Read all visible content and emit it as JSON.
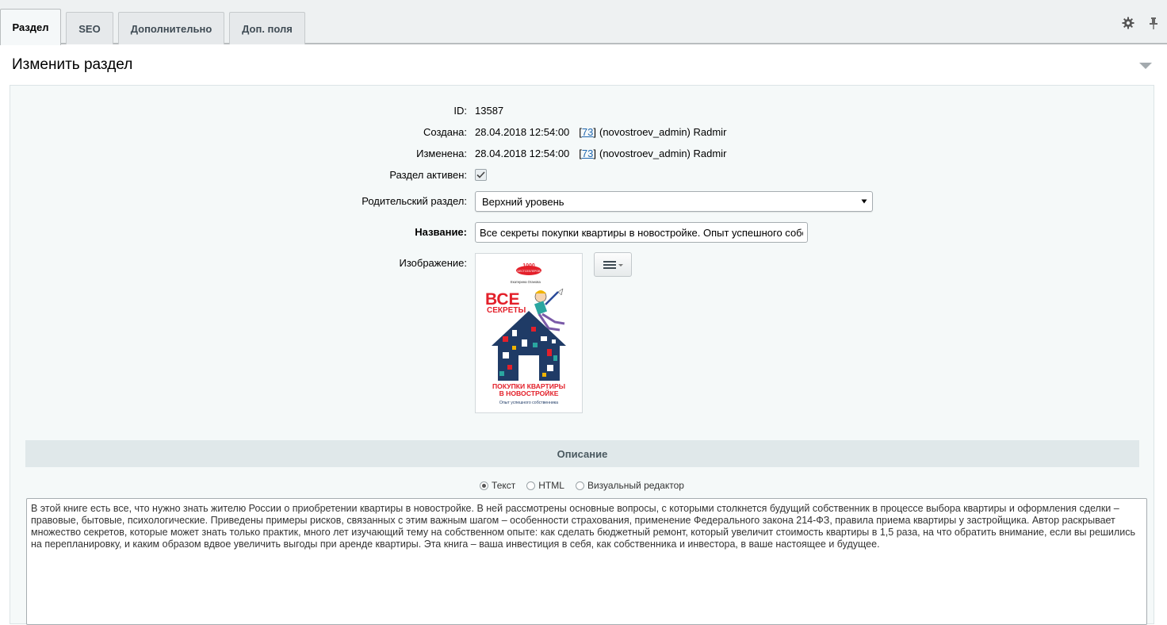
{
  "tabs": [
    {
      "label": "Раздел",
      "active": true
    },
    {
      "label": "SEO",
      "active": false
    },
    {
      "label": "Дополнительно",
      "active": false
    },
    {
      "label": "Доп. поля",
      "active": false
    }
  ],
  "header": {
    "title": "Изменить раздел"
  },
  "form": {
    "id": {
      "label": "ID:",
      "value": "13587"
    },
    "created": {
      "label": "Создана:",
      "date": "28.04.2018 12:54:00",
      "user_open": "[",
      "user_id": "73",
      "user_close": "]",
      "user_name": "(novostroev_admin) Radmir"
    },
    "modified": {
      "label": "Изменена:",
      "date": "28.04.2018 12:54:00",
      "user_open": "[",
      "user_id": "73",
      "user_close": "]",
      "user_name": "(novostroev_admin) Radmir"
    },
    "active": {
      "label": "Раздел активен:",
      "checked": true
    },
    "parent": {
      "label": "Родительский раздел:",
      "value": "Верхний уровень"
    },
    "name": {
      "label": "Название:",
      "value": "Все секреты покупки квартиры в новостройке. Опыт успешного собственника"
    },
    "image": {
      "label": "Изображение:",
      "cover": {
        "badge": "1000",
        "badge_sub": "БЕСТСЕЛЛЕРОВ",
        "author": "Екатерина Оганова",
        "title_big": "ВСЕ",
        "title_mid": "СЕКРЕТЫ",
        "title_bottom_1": "ПОКУПКИ КВАРТИРЫ",
        "title_bottom_2": "В НОВОСТРОЙКЕ",
        "subtitle": "Опыт успешного собственника"
      }
    }
  },
  "description": {
    "header": "Описание",
    "modes": [
      {
        "label": "Текст",
        "selected": true
      },
      {
        "label": "HTML",
        "selected": false
      },
      {
        "label": "Визуальный редактор",
        "selected": false
      }
    ],
    "text": "В этой книге есть все, что нужно знать жителю России о приобретении квартиры в новостройке. В ней рассмотрены основные вопросы, с которыми столкнется будущий собственник в процессе выбора квартиры и оформления сделки – правовые, бытовые, психологические. Приведены примеры рисков, связанных с этим важным шагом – особенности страхования, применение Федерального закона 214-ФЗ, правила приема квартиры у застройщика. Автор раскрывает множество секретов, которые может знать только практик, много лет изучающий тему на собственном опыте: как сделать бюджетный ремонт, который увеличит стоимость квартиры в 1,5 раза, на что обратить внимание, если вы решились на перепланировку, и каким образом вдвое увеличить выгоды при аренде квартиры. Эта книга – ваша инвестиция в себя, как собственника и инвестора, в ваше настоящее и будущее."
  },
  "icons": {
    "settings": "gear-icon",
    "pin": "pin-icon",
    "collapse": "triangle-down-icon",
    "menu": "hamburger-menu-icon"
  },
  "colors": {
    "link": "#2067b0",
    "cover_red": "#e3202a",
    "panel_bg": "#f5f9f9"
  }
}
